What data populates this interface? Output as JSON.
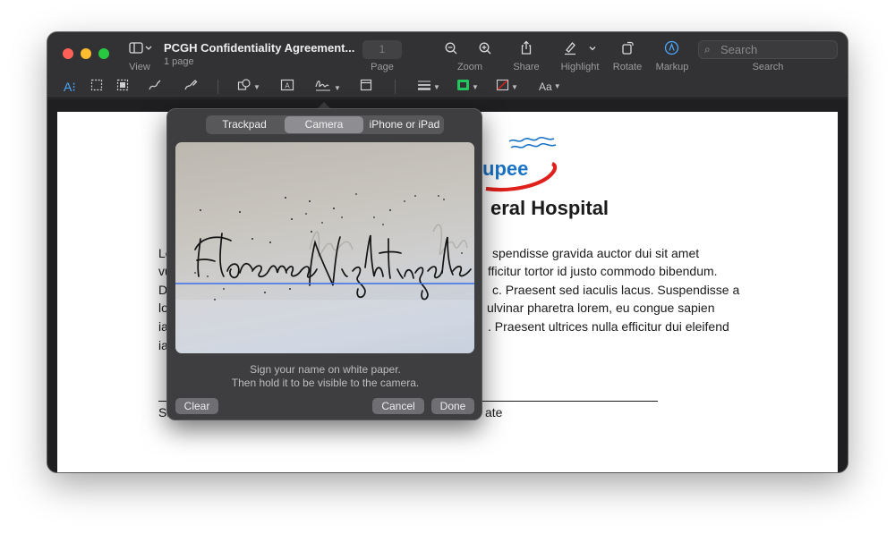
{
  "window": {
    "title": "PCGH Confidentiality Agreement...",
    "subtitle": "1 page"
  },
  "toolbar": {
    "view_label": "View",
    "page_value": "1",
    "page_label": "Page",
    "zoom_label": "Zoom",
    "share_label": "Share",
    "highlight_label": "Highlight",
    "rotate_label": "Rotate",
    "markup_label": "Markup",
    "search_placeholder": "Search",
    "search_label": "Search"
  },
  "markup_toolbar": {
    "text_style_label": "Aa",
    "border_color": "#22c55e",
    "markup_accent": "#4aa8ff"
  },
  "document": {
    "hospital_title_visible": "eral Hospital",
    "logo_text_visible": "upee",
    "logo_color": "#1a73c6",
    "logo_swoosh_color": "#e0201b",
    "paragraph_left": [
      "Lor",
      "vul",
      "Do",
      "lor",
      "iac",
      "iac"
    ],
    "paragraph_right": [
      "spendisse gravida auctor dui sit amet",
      "fficitur tortor id justo commodo bibendum.",
      "c. Praesent sed iaculis lacus. Suspendisse a",
      "ulvinar pharetra lorem, eu congue sapien",
      ". Praesent ultrices nulla efficitur dui eleifend"
    ],
    "signature_left": "Sig",
    "signature_right": "ate"
  },
  "signature_popover": {
    "tabs": [
      "Trackpad",
      "Camera",
      "iPhone or iPad"
    ],
    "active_tab": "Camera",
    "captured_signature": "Florence Nightingale",
    "instruction_line1": "Sign your name on white paper.",
    "instruction_line2": "Then hold it to be visible to the camera.",
    "clear_label": "Clear",
    "cancel_label": "Cancel",
    "done_label": "Done"
  }
}
